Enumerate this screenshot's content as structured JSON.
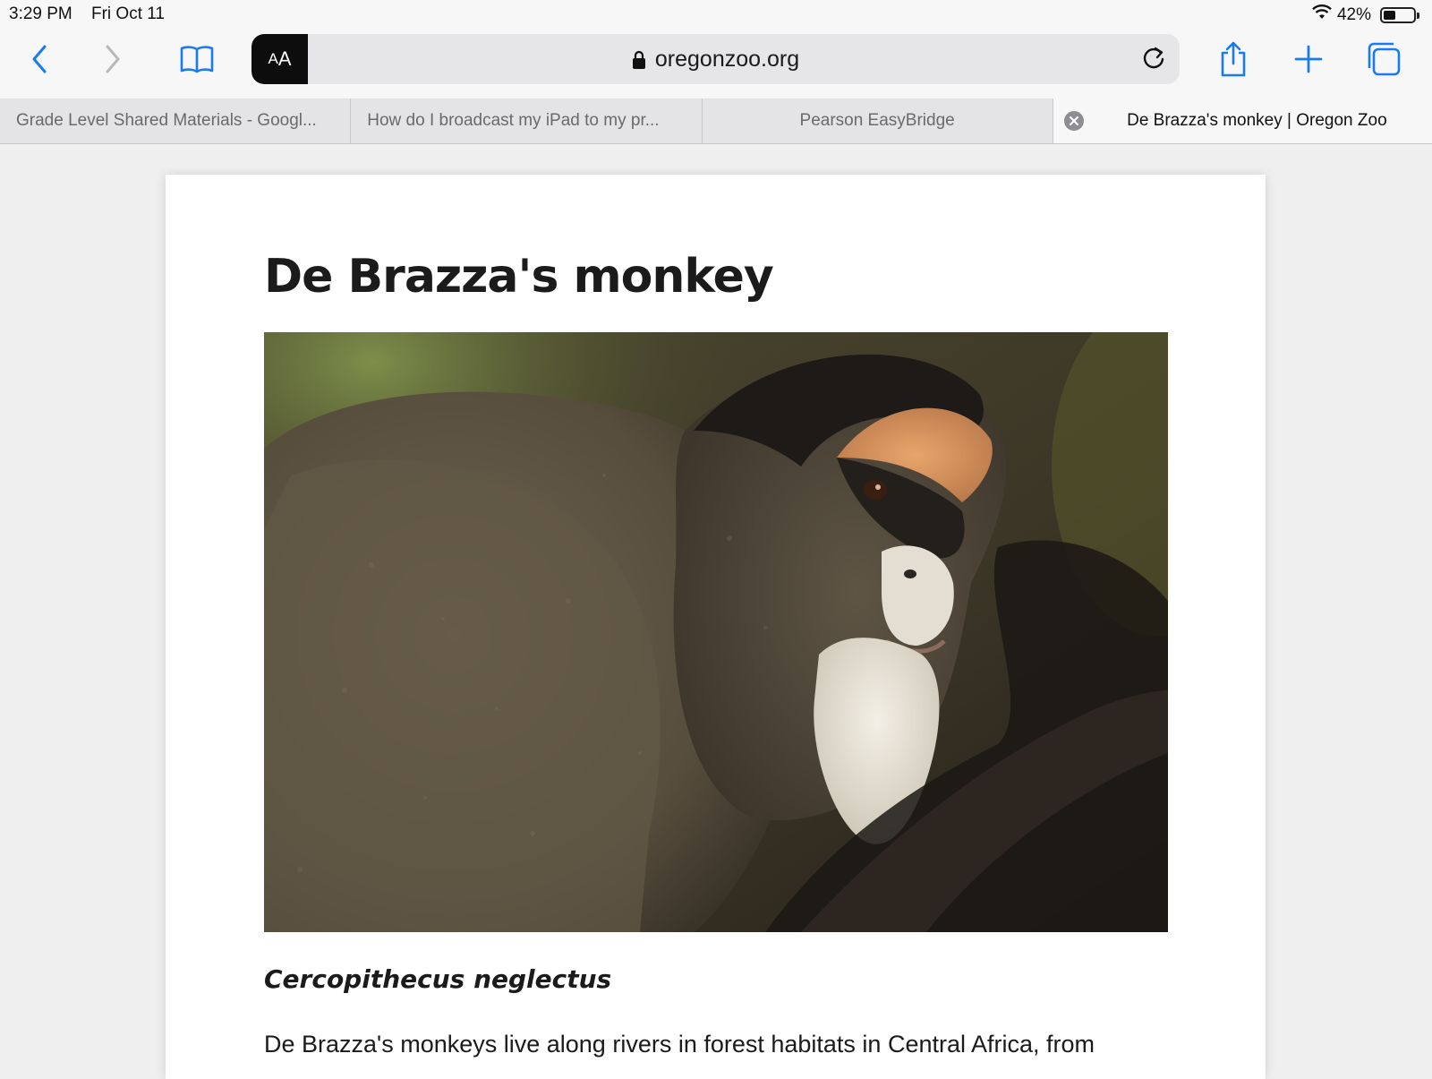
{
  "status_bar": {
    "time": "3:29 PM",
    "date": "Fri Oct 11",
    "battery_text": "42%",
    "battery_level": 0.42
  },
  "toolbar": {
    "reader_label_small": "A",
    "reader_label_large": "A",
    "url": "oregonzoo.org",
    "icons": [
      "back-icon",
      "forward-icon",
      "bookmarks-icon",
      "lock-icon",
      "reload-icon",
      "share-icon",
      "new-tab-icon",
      "tabs-icon"
    ]
  },
  "tabs": [
    {
      "label": "Grade Level Shared Materials - Googl..."
    },
    {
      "label": "How do I broadcast my iPad to my pr..."
    },
    {
      "label": "Pearson EasyBridge"
    },
    {
      "label": "De Brazza's monkey | Oregon Zoo",
      "active": true
    }
  ],
  "article": {
    "title": "De Brazza's monkey",
    "subtitle": "Cercopithecus neglectus",
    "body": "De Brazza's monkeys live along rivers in forest habitats in Central Africa, from"
  },
  "colors": {
    "accent": "#1a7bf0",
    "disabled": "#b8b8bc"
  }
}
